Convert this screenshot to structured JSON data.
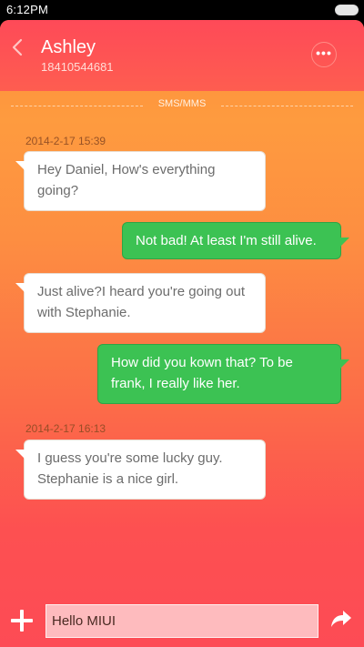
{
  "status_bar": {
    "time": "6:12PM"
  },
  "header": {
    "contact_name": "Ashley",
    "contact_number": "18410544681",
    "back_icon": "chevron-left-icon",
    "more_icon": "more-horizontal-icon"
  },
  "channel_label": "SMS/MMS",
  "messages": [
    {
      "timestamp": "2014-2-17 15:39"
    },
    {
      "direction": "incoming",
      "text": "Hey Daniel, How's everything going?"
    },
    {
      "direction": "outgoing",
      "text": "Not bad! At least I'm still alive."
    },
    {
      "direction": "incoming",
      "text": "Just  alive?I heard you're going out with Stephanie."
    },
    {
      "direction": "outgoing",
      "text": "How did you kown that? To be frank, I really like her."
    },
    {
      "timestamp": "2014-2-17 16:13"
    },
    {
      "direction": "incoming",
      "text": "I guess you're some lucky guy. Stephanie is a nice girl."
    }
  ],
  "composer": {
    "input_value": "Hello MIUI",
    "attach_icon": "plus-icon",
    "send_icon": "send-arrow-icon"
  },
  "colors": {
    "header": "#fe4a58",
    "incoming_bubble": "#ffffff",
    "outgoing_bubble": "#3cc253",
    "background_top": "#fe9b3f",
    "background_bottom": "#fd4b55"
  }
}
